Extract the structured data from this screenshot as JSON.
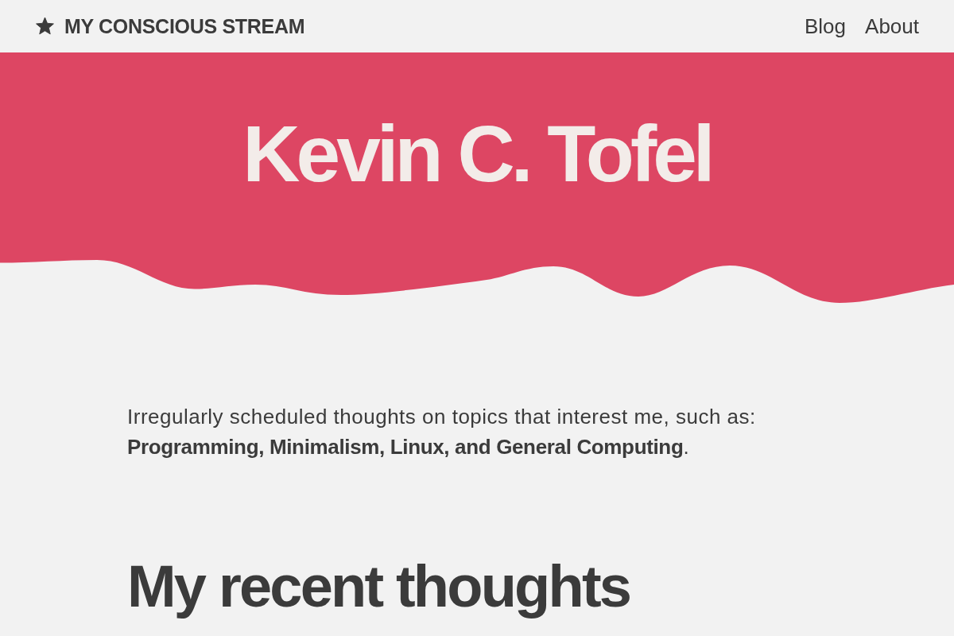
{
  "header": {
    "site_title": "MY CONSCIOUS STREAM",
    "nav": [
      "Blog",
      "About"
    ]
  },
  "hero": {
    "title": "Kevin C. Tofel"
  },
  "intro": {
    "text": "Irregularly scheduled thoughts on topics that interest me, such as: **Programming, Minimalism, Linux, and General Computing**."
  },
  "recent": {
    "heading": "My recent thoughts"
  }
}
